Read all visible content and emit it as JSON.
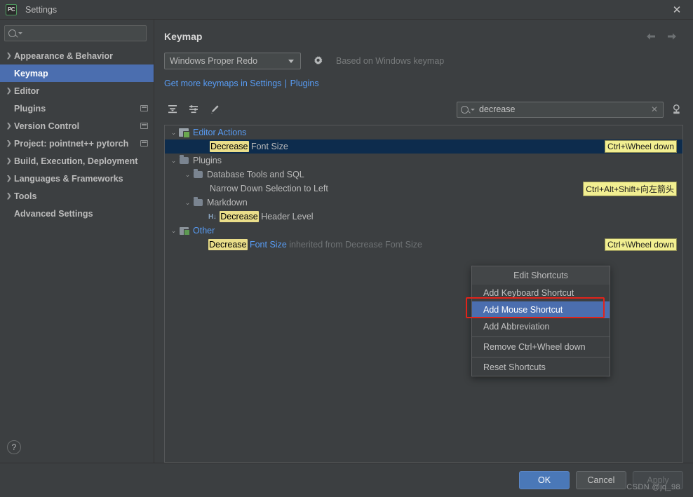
{
  "window": {
    "title": "Settings",
    "app_icon": "pycharm-icon",
    "app_icon_text": "PC",
    "close_label": "✕"
  },
  "sidebar": {
    "search": {
      "value": "",
      "placeholder": "",
      "icon": "search-icon"
    },
    "items": [
      {
        "label": "Appearance & Behavior",
        "expandable": true,
        "selected": false,
        "badge": false
      },
      {
        "label": "Keymap",
        "expandable": false,
        "selected": true,
        "badge": false
      },
      {
        "label": "Editor",
        "expandable": true,
        "selected": false,
        "badge": false
      },
      {
        "label": "Plugins",
        "expandable": false,
        "selected": false,
        "badge": true
      },
      {
        "label": "Version Control",
        "expandable": true,
        "selected": false,
        "badge": true
      },
      {
        "label": "Project: pointnet++ pytorch",
        "expandable": true,
        "selected": false,
        "badge": true
      },
      {
        "label": "Build, Execution, Deployment",
        "expandable": true,
        "selected": false,
        "badge": false
      },
      {
        "label": "Languages & Frameworks",
        "expandable": true,
        "selected": false,
        "badge": false
      },
      {
        "label": "Tools",
        "expandable": true,
        "selected": false,
        "badge": false
      },
      {
        "label": "Advanced Settings",
        "expandable": false,
        "selected": false,
        "badge": false
      }
    ],
    "help_label": "?"
  },
  "page": {
    "title": "Keymap",
    "nav_back": "back-arrow",
    "nav_forward": "forward-arrow",
    "keymap_select": {
      "value": "Windows Proper Redo"
    },
    "gear_icon": "gear-icon",
    "based_on": "Based on Windows keymap",
    "links": {
      "get_more": "Get more keymaps in Settings",
      "separator": "|",
      "plugins": "Plugins"
    },
    "toolbar": {
      "collapse_all": "collapse-all-icon",
      "expand_all": "expand-all-icon",
      "edit": "edit-pencil-icon"
    },
    "find": {
      "value": "decrease",
      "placeholder": "",
      "clear_label": "✕",
      "search_icon": "search-icon",
      "shortcut_search_icon": "keyboard-search-icon"
    }
  },
  "tree": {
    "rows": [
      {
        "indent": 0,
        "twisty": "⌄",
        "icon": "editor-actions-icon",
        "text_pre": "",
        "highlight": "",
        "text_post": "Editor Actions",
        "style": "linkish",
        "shortcut": "",
        "selected": false
      },
      {
        "indent": 3,
        "twisty": "",
        "icon": "",
        "text_pre": "",
        "highlight": "Decrease",
        "text_post": " Font Size",
        "style": "normal",
        "shortcut": "Ctrl+\\Wheel down",
        "selected": true
      },
      {
        "indent": 0,
        "twisty": "⌄",
        "icon": "folder-icon",
        "text_pre": "",
        "highlight": "",
        "text_post": "Plugins",
        "style": "normal",
        "shortcut": "",
        "selected": false
      },
      {
        "indent": 1,
        "twisty": "⌄",
        "icon": "folder-icon",
        "text_pre": "",
        "highlight": "",
        "text_post": "Database Tools and SQL",
        "style": "normal",
        "shortcut": "",
        "selected": false
      },
      {
        "indent": 3,
        "twisty": "",
        "icon": "",
        "text_pre": "Narrow Down Selection to Left",
        "highlight": "",
        "text_post": "",
        "style": "normal",
        "shortcut": "Ctrl+Alt+Shift+向左箭头",
        "selected": false
      },
      {
        "indent": 1,
        "twisty": "⌄",
        "icon": "folder-icon",
        "text_pre": "",
        "highlight": "",
        "text_post": "Markdown",
        "style": "normal",
        "shortcut": "",
        "selected": false
      },
      {
        "indent": 2,
        "twisty": "",
        "icon": "h1-icon",
        "text_pre": "",
        "highlight": "Decrease",
        "text_post": " Header Level",
        "style": "normal",
        "shortcut": "",
        "selected": false
      },
      {
        "indent": 0,
        "twisty": "⌄",
        "icon": "plugin-icon",
        "text_pre": "",
        "highlight": "",
        "text_post": "Other",
        "style": "linkish",
        "shortcut": "",
        "selected": false
      },
      {
        "indent": 2,
        "twisty": "",
        "icon": "",
        "text_pre": "",
        "highlight": "Decrease",
        "text_post": " Font Size",
        "text_muted": " inherited from Decrease Font Size",
        "style": "linkish",
        "shortcut": "Ctrl+\\Wheel down",
        "selected": false
      }
    ]
  },
  "context_menu": {
    "title": "Edit Shortcuts",
    "items": [
      {
        "label": "Add Keyboard Shortcut",
        "active": false
      },
      {
        "label": "Add Mouse Shortcut",
        "active": true
      },
      {
        "label": "Add Abbreviation",
        "active": false
      },
      {
        "label": "Remove Ctrl+Wheel down",
        "active": false
      },
      {
        "label": "Reset Shortcuts",
        "active": false
      }
    ],
    "annotation_color": "#e2231a"
  },
  "footer": {
    "ok": "OK",
    "cancel": "Cancel",
    "apply": "Apply",
    "watermark": "CSDN @jq_98"
  },
  "colors": {
    "background": "#3c3f41",
    "selection_blue": "#4b6eaf",
    "row_selected": "#0d2c4d",
    "link": "#589df6",
    "highlight_yellow": "#eade8a",
    "shortcut_yellow": "#f2ef91",
    "accent_red": "#e2231a",
    "primary_button": "#4a78b8"
  }
}
